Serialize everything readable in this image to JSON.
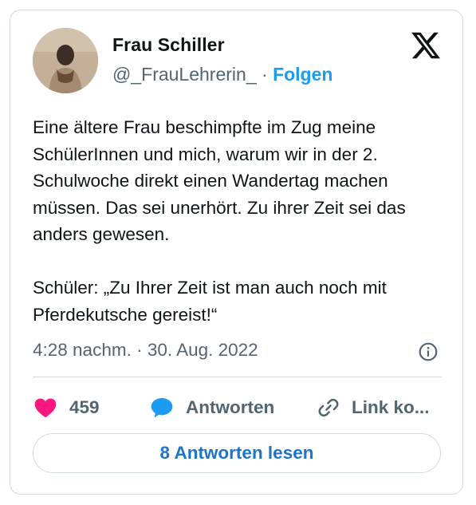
{
  "author": {
    "name": "Frau Schiller",
    "handle": "@_FrauLehrerin_",
    "separator": "·",
    "follow_label": "Folgen"
  },
  "tweet": {
    "paragraphs": [
      "Eine ältere Frau beschimpfte im Zug meine SchülerInnen und mich, warum wir in der 2. Schulwoche direkt einen Wandertag machen müssen. Das sei unerhört. Zu ihrer Zeit sei das anders gewesen.",
      "Schüler: „Zu Ihrer Zeit ist man auch noch mit Pferdekutsche gereist!“"
    ],
    "timestamp": "4:28 nachm. · 30. Aug. 2022"
  },
  "actions": {
    "like_count": "459",
    "reply_label": "Antworten",
    "copy_link_label": "Link ko..."
  },
  "read_replies_label": "8 Antworten lesen",
  "icons": {
    "logo": "x-logo-icon",
    "info": "info-icon",
    "like": "heart-icon",
    "reply": "speech-bubble-icon",
    "copy": "link-icon"
  },
  "colors": {
    "heart": "#f91880",
    "reply_bubble": "#1d9bf0",
    "follow": "#1d9bf0",
    "read_button_text": "#1d74c9",
    "secondary_text": "#536471"
  }
}
